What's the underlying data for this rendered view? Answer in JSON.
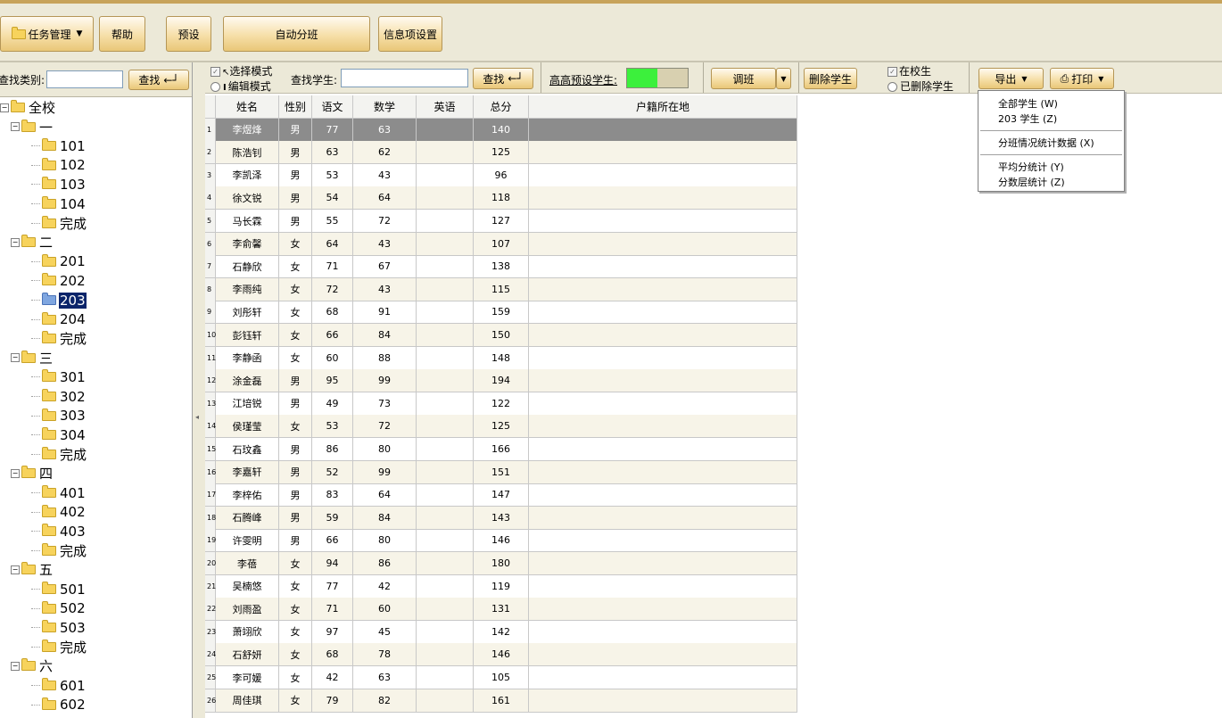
{
  "toolbar": {
    "task_mgmt": "任务管理",
    "help": "帮助",
    "preset": "预设",
    "auto_class": "自动分班",
    "info_settings": "信息项设置"
  },
  "left": {
    "search_label": "查找类别:",
    "search_button": "查找",
    "tree": [
      {
        "label": "全校",
        "level": 0
      },
      {
        "label": "一",
        "level": 1
      },
      {
        "label": "101",
        "level": 2
      },
      {
        "label": "102",
        "level": 2
      },
      {
        "label": "103",
        "level": 2
      },
      {
        "label": "104",
        "level": 2
      },
      {
        "label": "完成",
        "level": 2
      },
      {
        "label": "二",
        "level": 1
      },
      {
        "label": "201",
        "level": 2
      },
      {
        "label": "202",
        "level": 2
      },
      {
        "label": "203",
        "level": 2,
        "selected": true
      },
      {
        "label": "204",
        "level": 2
      },
      {
        "label": "完成",
        "level": 2
      },
      {
        "label": "三",
        "level": 1
      },
      {
        "label": "301",
        "level": 2
      },
      {
        "label": "302",
        "level": 2
      },
      {
        "label": "303",
        "level": 2
      },
      {
        "label": "304",
        "level": 2
      },
      {
        "label": "完成",
        "level": 2
      },
      {
        "label": "四",
        "level": 1
      },
      {
        "label": "401",
        "level": 2
      },
      {
        "label": "402",
        "level": 2
      },
      {
        "label": "403",
        "level": 2
      },
      {
        "label": "完成",
        "level": 2
      },
      {
        "label": "五",
        "level": 1
      },
      {
        "label": "501",
        "level": 2
      },
      {
        "label": "502",
        "level": 2
      },
      {
        "label": "503",
        "level": 2
      },
      {
        "label": "完成",
        "level": 2
      },
      {
        "label": "六",
        "level": 1
      },
      {
        "label": "601",
        "level": 2
      },
      {
        "label": "602",
        "level": 2
      }
    ]
  },
  "mid": {
    "select_mode": "选择模式",
    "edit_mode": "编辑模式",
    "search_student_label": "查找学生:",
    "search_button": "查找",
    "high_preset_label": "高高预设学生:",
    "adjust_class": "调班",
    "delete_student": "删除学生",
    "in_school": "在校生",
    "deleted_students": "已删除学生",
    "export": "导出",
    "print": "打印"
  },
  "table": {
    "headers": [
      "姓名",
      "性别",
      "语文",
      "数学",
      "英语",
      "总分",
      "户籍所在地"
    ],
    "rows": [
      [
        "1",
        "李煜烽",
        "男",
        "77",
        "63",
        "",
        "140",
        ""
      ],
      [
        "2",
        "陈浩钊",
        "男",
        "63",
        "62",
        "",
        "125",
        ""
      ],
      [
        "3",
        "李凯泽",
        "男",
        "53",
        "43",
        "",
        "96",
        ""
      ],
      [
        "4",
        "徐文锐",
        "男",
        "54",
        "64",
        "",
        "118",
        ""
      ],
      [
        "5",
        "马长霖",
        "男",
        "55",
        "72",
        "",
        "127",
        ""
      ],
      [
        "6",
        "李俞馨",
        "女",
        "64",
        "43",
        "",
        "107",
        ""
      ],
      [
        "7",
        "石静欣",
        "女",
        "71",
        "67",
        "",
        "138",
        ""
      ],
      [
        "8",
        "李雨纯",
        "女",
        "72",
        "43",
        "",
        "115",
        ""
      ],
      [
        "9",
        "刘彤轩",
        "女",
        "68",
        "91",
        "",
        "159",
        ""
      ],
      [
        "10",
        "彭钰轩",
        "女",
        "66",
        "84",
        "",
        "150",
        ""
      ],
      [
        "11",
        "李静函",
        "女",
        "60",
        "88",
        "",
        "148",
        ""
      ],
      [
        "12",
        "涂金磊",
        "男",
        "95",
        "99",
        "",
        "194",
        ""
      ],
      [
        "13",
        "江培锐",
        "男",
        "49",
        "73",
        "",
        "122",
        ""
      ],
      [
        "14",
        "侯瑾莹",
        "女",
        "53",
        "72",
        "",
        "125",
        ""
      ],
      [
        "15",
        "石玟鑫",
        "男",
        "86",
        "80",
        "",
        "166",
        ""
      ],
      [
        "16",
        "李嘉轩",
        "男",
        "52",
        "99",
        "",
        "151",
        ""
      ],
      [
        "17",
        "李梓佑",
        "男",
        "83",
        "64",
        "",
        "147",
        ""
      ],
      [
        "18",
        "石腾峰",
        "男",
        "59",
        "84",
        "",
        "143",
        ""
      ],
      [
        "19",
        "许雯明",
        "男",
        "66",
        "80",
        "",
        "146",
        ""
      ],
      [
        "20",
        "李蓓",
        "女",
        "94",
        "86",
        "",
        "180",
        ""
      ],
      [
        "21",
        "吴楠悠",
        "女",
        "77",
        "42",
        "",
        "119",
        ""
      ],
      [
        "22",
        "刘雨盈",
        "女",
        "71",
        "60",
        "",
        "131",
        ""
      ],
      [
        "23",
        "萧翊欣",
        "女",
        "97",
        "45",
        "",
        "142",
        ""
      ],
      [
        "24",
        "石舒妍",
        "女",
        "68",
        "78",
        "",
        "146",
        ""
      ],
      [
        "25",
        "李可媛",
        "女",
        "42",
        "63",
        "",
        "105",
        ""
      ],
      [
        "26",
        "周佳琪",
        "女",
        "79",
        "82",
        "",
        "161",
        ""
      ]
    ]
  },
  "menu": {
    "all_students": "全部学生 (W)",
    "class_students": "203 学生 (Z)",
    "stats": "分班情况统计数据 (X)",
    "avg_stats": "平均分统计 (Y)",
    "tier_stats": "分数层统计 (Z)"
  }
}
